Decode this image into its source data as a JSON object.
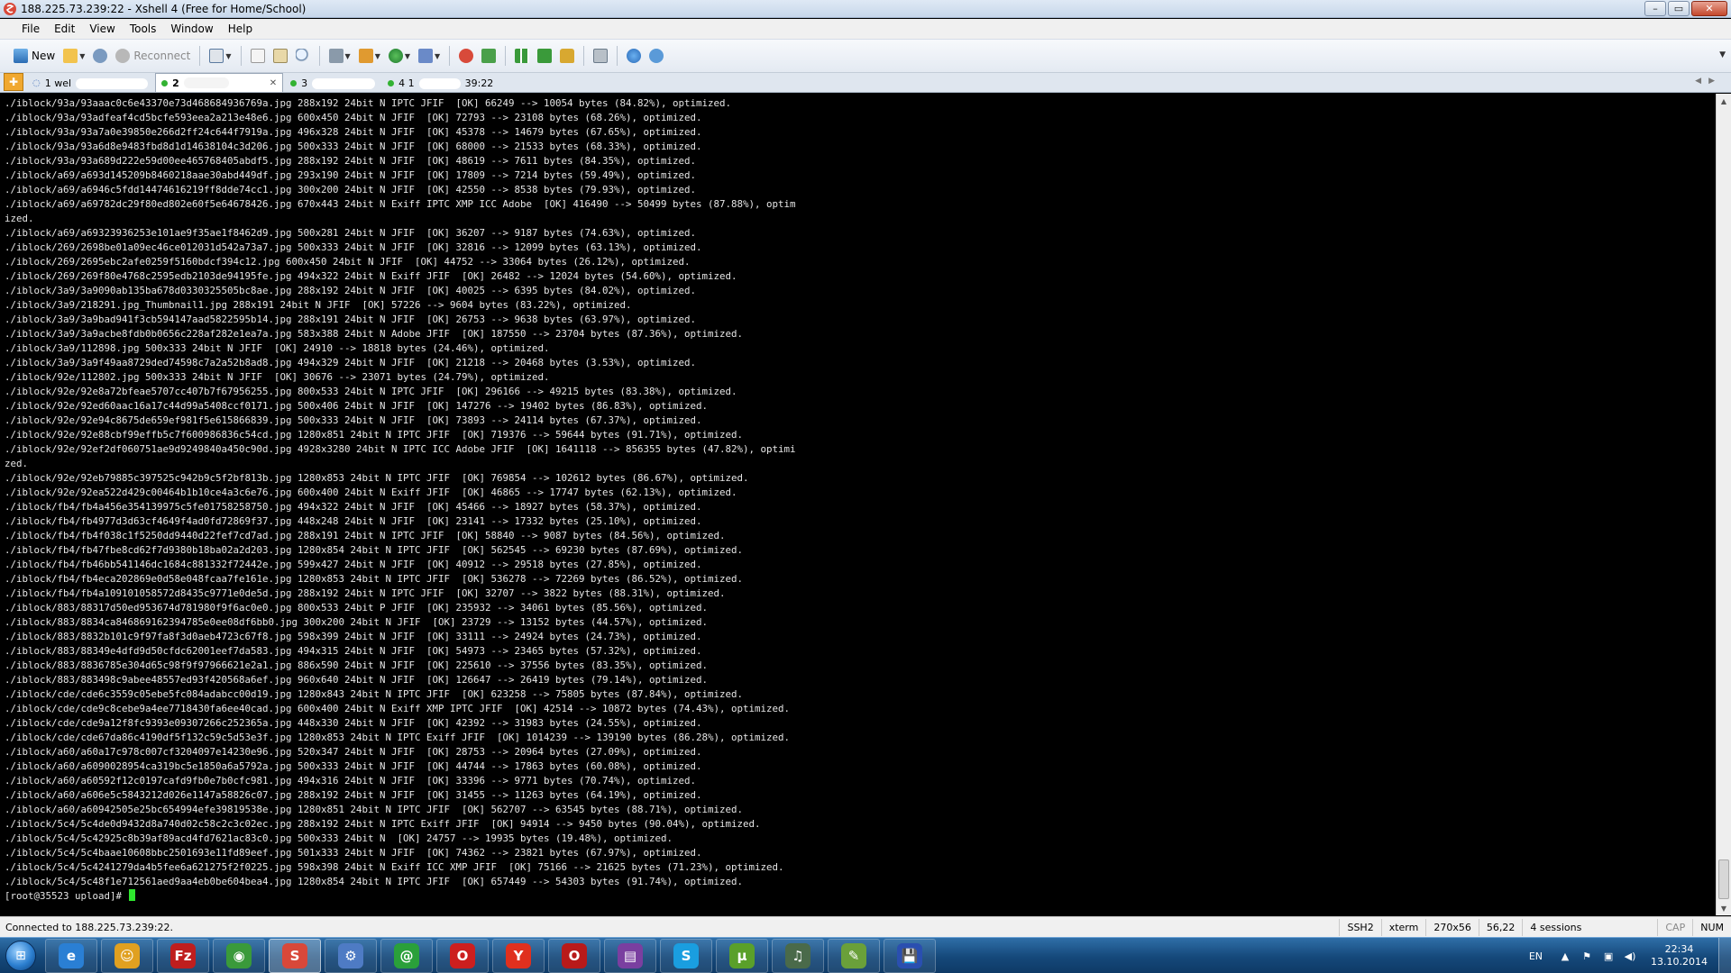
{
  "window": {
    "title": "188.225.73.239:22 - Xshell 4 (Free for Home/School)",
    "controls": {
      "minimize": "–",
      "maximize": "▭",
      "close": "✕"
    }
  },
  "menu": [
    "File",
    "Edit",
    "View",
    "Tools",
    "Window",
    "Help"
  ],
  "toolbar": {
    "new_label": "New",
    "reconnect_label": "Reconnect"
  },
  "tabs": [
    {
      "label": "1 wel",
      "status": "disconnected"
    },
    {
      "label": "2",
      "status": "connected",
      "active": true
    },
    {
      "label": "3",
      "status": "connected"
    },
    {
      "label": "4 1",
      "suffix": "39:22",
      "status": "connected"
    }
  ],
  "terminal": {
    "lines": [
      "./iblock/93a/93aaac0c6e43370e73d468684936769a.jpg 288x192 24bit N IPTC JFIF  [OK] 66249 --> 10054 bytes (84.82%), optimized.",
      "./iblock/93a/93adfeaf4cd5bcfe593eea2a213e48e6.jpg 600x450 24bit N JFIF  [OK] 72793 --> 23108 bytes (68.26%), optimized.",
      "./iblock/93a/93a7a0e39850e266d2ff24c644f7919a.jpg 496x328 24bit N JFIF  [OK] 45378 --> 14679 bytes (67.65%), optimized.",
      "./iblock/93a/93a6d8e9483fbd8d1d14638104c3d206.jpg 500x333 24bit N JFIF  [OK] 68000 --> 21533 bytes (68.33%), optimized.",
      "./iblock/93a/93a689d222e59d00ee465768405abdf5.jpg 288x192 24bit N JFIF  [OK] 48619 --> 7611 bytes (84.35%), optimized.",
      "./iblock/a69/a693d145209b8460218aae30abd449df.jpg 293x190 24bit N JFIF  [OK] 17809 --> 7214 bytes (59.49%), optimized.",
      "./iblock/a69/a6946c5fdd14474616219ff8dde74cc1.jpg 300x200 24bit N JFIF  [OK] 42550 --> 8538 bytes (79.93%), optimized.",
      "./iblock/a69/a69782dc29f80ed802e60f5e64678426.jpg 670x443 24bit N Exiff IPTC XMP ICC Adobe  [OK] 416490 --> 50499 bytes (87.88%), optim",
      "ized.",
      "./iblock/a69/a69323936253e101ae9f35ae1f8462d9.jpg 500x281 24bit N JFIF  [OK] 36207 --> 9187 bytes (74.63%), optimized.",
      "./iblock/269/2698be01a09ec46ce012031d542a73a7.jpg 500x333 24bit N JFIF  [OK] 32816 --> 12099 bytes (63.13%), optimized.",
      "./iblock/269/2695ebc2afe0259f5160bdcf394c12.jpg 600x450 24bit N JFIF  [OK] 44752 --> 33064 bytes (26.12%), optimized.",
      "./iblock/269/269f80e4768c2595edb2103de94195fe.jpg 494x322 24bit N Exiff JFIF  [OK] 26482 --> 12024 bytes (54.60%), optimized.",
      "./iblock/3a9/3a9090ab135ba678d0330325505bc8ae.jpg 288x192 24bit N JFIF  [OK] 40025 --> 6395 bytes (84.02%), optimized.",
      "./iblock/3a9/218291.jpg_Thumbnail1.jpg 288x191 24bit N JFIF  [OK] 57226 --> 9604 bytes (83.22%), optimized.",
      "./iblock/3a9/3a9bad941f3cb594147aad5822595b14.jpg 288x191 24bit N JFIF  [OK] 26753 --> 9638 bytes (63.97%), optimized.",
      "./iblock/3a9/3a9acbe8fdb0b0656c228af282e1ea7a.jpg 583x388 24bit N Adobe JFIF  [OK] 187550 --> 23704 bytes (87.36%), optimized.",
      "./iblock/3a9/112898.jpg 500x333 24bit N JFIF  [OK] 24910 --> 18818 bytes (24.46%), optimized.",
      "./iblock/3a9/3a9f49aa8729ded74598c7a2a52b8ad8.jpg 494x329 24bit N JFIF  [OK] 21218 --> 20468 bytes (3.53%), optimized.",
      "./iblock/92e/112802.jpg 500x333 24bit N JFIF  [OK] 30676 --> 23071 bytes (24.79%), optimized.",
      "./iblock/92e/92e8a72bfeae5707cc407b7f67956255.jpg 800x533 24bit N IPTC JFIF  [OK] 296166 --> 49215 bytes (83.38%), optimized.",
      "./iblock/92e/92ed60aac16a17c44d99a5408ccf0171.jpg 500x406 24bit N JFIF  [OK] 147276 --> 19402 bytes (86.83%), optimized.",
      "./iblock/92e/92e94c8675de659ef981f5e615866839.jpg 500x333 24bit N JFIF  [OK] 73893 --> 24114 bytes (67.37%), optimized.",
      "./iblock/92e/92e88cbf99effb5c7f600986836c54cd.jpg 1280x851 24bit N IPTC JFIF  [OK] 719376 --> 59644 bytes (91.71%), optimized.",
      "./iblock/92e/92ef2df060751ae9d9249840a450c90d.jpg 4928x3280 24bit N IPTC ICC Adobe JFIF  [OK] 1641118 --> 856355 bytes (47.82%), optimi",
      "zed.",
      "./iblock/92e/92eb79885c397525c942b9c5f2bf813b.jpg 1280x853 24bit N IPTC JFIF  [OK] 769854 --> 102612 bytes (86.67%), optimized.",
      "./iblock/92e/92ea522d429c00464b1b10ce4a3c6e76.jpg 600x400 24bit N Exiff JFIF  [OK] 46865 --> 17747 bytes (62.13%), optimized.",
      "./iblock/fb4/fb4a456e354139975c5fe01758258750.jpg 494x322 24bit N JFIF  [OK] 45466 --> 18927 bytes (58.37%), optimized.",
      "./iblock/fb4/fb4977d3d63cf4649f4ad0fd72869f37.jpg 448x248 24bit N JFIF  [OK] 23141 --> 17332 bytes (25.10%), optimized.",
      "./iblock/fb4/fb4f038c1f5250dd9440d22fef7cd7ad.jpg 288x191 24bit N IPTC JFIF  [OK] 58840 --> 9087 bytes (84.56%), optimized.",
      "./iblock/fb4/fb47fbe8cd62f7d9380b18ba02a2d203.jpg 1280x854 24bit N IPTC JFIF  [OK] 562545 --> 69230 bytes (87.69%), optimized.",
      "./iblock/fb4/fb46bb541146dc1684c881332f72442e.jpg 599x427 24bit N JFIF  [OK] 40912 --> 29518 bytes (27.85%), optimized.",
      "./iblock/fb4/fb4eca202869e0d58e048fcaa7fe161e.jpg 1280x853 24bit N IPTC JFIF  [OK] 536278 --> 72269 bytes (86.52%), optimized.",
      "./iblock/fb4/fb4a109101058572d8435c9771e0de5d.jpg 288x192 24bit N IPTC JFIF  [OK] 32707 --> 3822 bytes (88.31%), optimized.",
      "./iblock/883/88317d50ed953674d781980f9f6ac0e0.jpg 800x533 24bit P JFIF  [OK] 235932 --> 34061 bytes (85.56%), optimized.",
      "./iblock/883/8834ca846869162394785e0ee08df6bb0.jpg 300x200 24bit N JFIF  [OK] 23729 --> 13152 bytes (44.57%), optimized.",
      "./iblock/883/8832b101c9f97fa8f3d0aeb4723c67f8.jpg 598x399 24bit N JFIF  [OK] 33111 --> 24924 bytes (24.73%), optimized.",
      "./iblock/883/88349e4dfd9d50cfdc62001eef7da583.jpg 494x315 24bit N JFIF  [OK] 54973 --> 23465 bytes (57.32%), optimized.",
      "./iblock/883/8836785e304d65c98f9f97966621e2a1.jpg 886x590 24bit N JFIF  [OK] 225610 --> 37556 bytes (83.35%), optimized.",
      "./iblock/883/883498c9abee48557ed93f420568a6ef.jpg 960x640 24bit N JFIF  [OK] 126647 --> 26419 bytes (79.14%), optimized.",
      "./iblock/cde/cde6c3559c05ebe5fc084adabcc00d19.jpg 1280x843 24bit N IPTC JFIF  [OK] 623258 --> 75805 bytes (87.84%), optimized.",
      "./iblock/cde/cde9c8cebe9a4ee7718430fa6ee40cad.jpg 600x400 24bit N Exiff XMP IPTC JFIF  [OK] 42514 --> 10872 bytes (74.43%), optimized.",
      "./iblock/cde/cde9a12f8fc9393e09307266c252365a.jpg 448x330 24bit N JFIF  [OK] 42392 --> 31983 bytes (24.55%), optimized.",
      "./iblock/cde/cde67da86c4190df5f132c59c5d53e3f.jpg 1280x853 24bit N IPTC Exiff JFIF  [OK] 1014239 --> 139190 bytes (86.28%), optimized.",
      "./iblock/a60/a60a17c978c007cf3204097e14230e96.jpg 520x347 24bit N JFIF  [OK] 28753 --> 20964 bytes (27.09%), optimized.",
      "./iblock/a60/a6090028954ca319bc5e1850a6a5792a.jpg 500x333 24bit N JFIF  [OK] 44744 --> 17863 bytes (60.08%), optimized.",
      "./iblock/a60/a60592f12c0197cafd9fb0e7b0cfc981.jpg 494x316 24bit N JFIF  [OK] 33396 --> 9771 bytes (70.74%), optimized.",
      "./iblock/a60/a606e5c5843212d026e1147a58826c07.jpg 288x192 24bit N JFIF  [OK] 31455 --> 11263 bytes (64.19%), optimized.",
      "./iblock/a60/a60942505e25bc654994efe39819538e.jpg 1280x851 24bit N IPTC JFIF  [OK] 562707 --> 63545 bytes (88.71%), optimized.",
      "./iblock/5c4/5c4de0d9432d8a740d02c58c2c3c02ec.jpg 288x192 24bit N IPTC Exiff JFIF  [OK] 94914 --> 9450 bytes (90.04%), optimized.",
      "./iblock/5c4/5c42925c8b39af89acd4fd7621ac83c0.jpg 500x333 24bit N  [OK] 24757 --> 19935 bytes (19.48%), optimized.",
      "./iblock/5c4/5c4baae10608bbc2501693e11fd89eef.jpg 501x333 24bit N JFIF  [OK] 74362 --> 23821 bytes (67.97%), optimized.",
      "./iblock/5c4/5c4241279da4b5fee6a621275f2f0225.jpg 598x398 24bit N Exiff ICC XMP JFIF  [OK] 75166 --> 21625 bytes (71.23%), optimized.",
      "./iblock/5c4/5c48f1e712561aed9aa4eb0be604bea4.jpg 1280x854 24bit N IPTC JFIF  [OK] 657449 --> 54303 bytes (91.74%), optimized."
    ],
    "prompt": "[root@35523 upload]# "
  },
  "status": {
    "connection": "Connected to 188.225.73.239:22.",
    "protocol": "SSH2",
    "term": "xterm",
    "size": "270x56",
    "cursor_pos": "56,22",
    "sessions": "4 sessions",
    "caps": "CAP",
    "num": "NUM"
  },
  "taskbar": {
    "apps": [
      {
        "name": "internet-explorer",
        "glyph": "e",
        "color": "#2a7fd4"
      },
      {
        "name": "messenger",
        "glyph": "☺",
        "color": "#e0a020"
      },
      {
        "name": "filezilla",
        "glyph": "Fz",
        "color": "#bf1e1e"
      },
      {
        "name": "chrome",
        "glyph": "◉",
        "color": "#3a9a3a"
      },
      {
        "name": "xshell",
        "glyph": "S",
        "color": "#d8483a",
        "active": true
      },
      {
        "name": "network-tool",
        "glyph": "⚙",
        "color": "#4e7bc4"
      },
      {
        "name": "mail-agent",
        "glyph": "@",
        "color": "#2aa03a"
      },
      {
        "name": "opera",
        "glyph": "O",
        "color": "#cc1f1f"
      },
      {
        "name": "yandex-browser",
        "glyph": "Y",
        "color": "#e0301e"
      },
      {
        "name": "opera-next",
        "glyph": "O",
        "color": "#b81a1a"
      },
      {
        "name": "winrar",
        "glyph": "▤",
        "color": "#7a3fa0"
      },
      {
        "name": "skype",
        "glyph": "S",
        "color": "#1a9ee0"
      },
      {
        "name": "utorrent",
        "glyph": "µ",
        "color": "#5aa02a"
      },
      {
        "name": "audio-player",
        "glyph": "♫",
        "color": "#4a6a4a"
      },
      {
        "name": "notepad",
        "glyph": "✎",
        "color": "#6aa03a"
      },
      {
        "name": "floppy-save",
        "glyph": "💾",
        "color": "#2a4fb0"
      }
    ],
    "lang": "EN",
    "time": "22:34",
    "date": "13.10.2014"
  }
}
